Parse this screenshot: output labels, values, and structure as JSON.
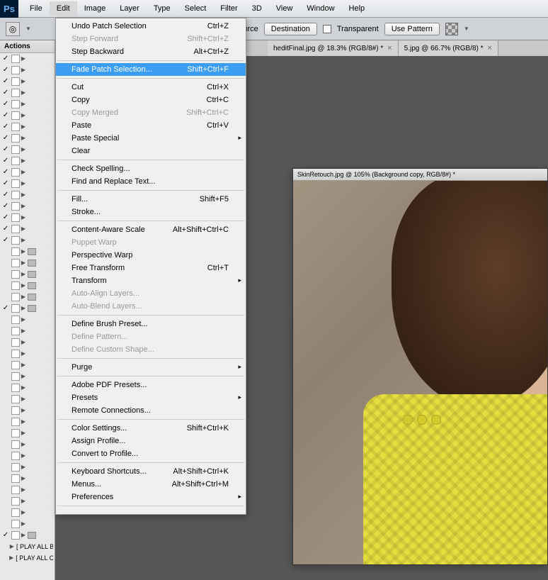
{
  "menubar": [
    "File",
    "Edit",
    "Image",
    "Layer",
    "Type",
    "Select",
    "Filter",
    "3D",
    "View",
    "Window",
    "Help"
  ],
  "active_menu": "Edit",
  "toolbar": {
    "source": "Source",
    "destination": "Destination",
    "transparent": "Transparent",
    "use_pattern": "Use Pattern"
  },
  "tabs": [
    {
      "label": "heditFinal.jpg @ 18.3% (RGB/8#) *"
    },
    {
      "label": "5.jpg @ 66.7% (RGB/8) *"
    }
  ],
  "doc_title": "SkinRetouch.jpg @ 105% (Background copy, RGB/8#) *",
  "actions_header": "Actions",
  "action_rows": [
    {
      "chk": true,
      "box": true,
      "arrow": true,
      "folder": false,
      "label": ""
    },
    {
      "chk": true,
      "box": true,
      "arrow": true,
      "folder": false,
      "label": ""
    },
    {
      "chk": true,
      "box": true,
      "arrow": true,
      "folder": false,
      "label": ""
    },
    {
      "chk": true,
      "box": true,
      "arrow": true,
      "folder": false,
      "label": ""
    },
    {
      "chk": true,
      "box": true,
      "arrow": true,
      "folder": false,
      "label": ""
    },
    {
      "chk": true,
      "box": true,
      "arrow": true,
      "folder": false,
      "label": ""
    },
    {
      "chk": true,
      "box": true,
      "arrow": true,
      "folder": false,
      "label": ""
    },
    {
      "chk": true,
      "box": true,
      "arrow": true,
      "folder": false,
      "label": ""
    },
    {
      "chk": true,
      "box": true,
      "arrow": true,
      "folder": false,
      "label": ""
    },
    {
      "chk": true,
      "box": true,
      "arrow": true,
      "folder": false,
      "label": ""
    },
    {
      "chk": true,
      "box": true,
      "arrow": true,
      "folder": false,
      "label": ""
    },
    {
      "chk": true,
      "box": true,
      "arrow": true,
      "folder": false,
      "label": ""
    },
    {
      "chk": true,
      "box": true,
      "arrow": true,
      "folder": false,
      "label": ""
    },
    {
      "chk": true,
      "box": true,
      "arrow": true,
      "folder": false,
      "label": ""
    },
    {
      "chk": true,
      "box": true,
      "arrow": true,
      "folder": false,
      "label": ""
    },
    {
      "chk": true,
      "box": true,
      "arrow": true,
      "folder": false,
      "label": ""
    },
    {
      "chk": true,
      "box": true,
      "arrow": true,
      "folder": false,
      "label": ""
    },
    {
      "chk": false,
      "box": true,
      "arrow": true,
      "folder": true,
      "label": ""
    },
    {
      "chk": false,
      "box": true,
      "arrow": true,
      "folder": true,
      "label": ""
    },
    {
      "chk": false,
      "box": true,
      "arrow": true,
      "folder": true,
      "label": ""
    },
    {
      "chk": false,
      "box": true,
      "arrow": true,
      "folder": true,
      "label": ""
    },
    {
      "chk": false,
      "box": true,
      "arrow": true,
      "folder": true,
      "label": ""
    },
    {
      "chk": true,
      "box": true,
      "arrow": true,
      "folder": true,
      "label": ""
    },
    {
      "chk": false,
      "box": true,
      "arrow": true,
      "folder": false,
      "label": ""
    },
    {
      "chk": false,
      "box": true,
      "arrow": true,
      "folder": false,
      "label": ""
    },
    {
      "chk": false,
      "box": true,
      "arrow": true,
      "folder": false,
      "label": ""
    },
    {
      "chk": false,
      "box": true,
      "arrow": true,
      "folder": false,
      "label": ""
    },
    {
      "chk": false,
      "box": true,
      "arrow": true,
      "folder": false,
      "label": ""
    },
    {
      "chk": false,
      "box": true,
      "arrow": true,
      "folder": false,
      "label": ""
    },
    {
      "chk": false,
      "box": true,
      "arrow": true,
      "folder": false,
      "label": ""
    },
    {
      "chk": false,
      "box": true,
      "arrow": true,
      "folder": false,
      "label": ""
    },
    {
      "chk": false,
      "box": true,
      "arrow": true,
      "folder": false,
      "label": ""
    },
    {
      "chk": false,
      "box": true,
      "arrow": true,
      "folder": false,
      "label": ""
    },
    {
      "chk": false,
      "box": true,
      "arrow": true,
      "folder": false,
      "label": ""
    },
    {
      "chk": false,
      "box": true,
      "arrow": true,
      "folder": false,
      "label": ""
    },
    {
      "chk": false,
      "box": true,
      "arrow": true,
      "folder": false,
      "label": ""
    },
    {
      "chk": false,
      "box": true,
      "arrow": true,
      "folder": false,
      "label": ""
    },
    {
      "chk": false,
      "box": true,
      "arrow": true,
      "folder": false,
      "label": ""
    },
    {
      "chk": false,
      "box": true,
      "arrow": true,
      "folder": false,
      "label": ""
    },
    {
      "chk": false,
      "box": true,
      "arrow": true,
      "folder": false,
      "label": ""
    },
    {
      "chk": false,
      "box": true,
      "arrow": true,
      "folder": false,
      "label": ""
    },
    {
      "chk": false,
      "box": true,
      "arrow": true,
      "folder": false,
      "label": ""
    },
    {
      "chk": true,
      "box": true,
      "arrow": true,
      "folder": true,
      "label": ""
    },
    {
      "chk": false,
      "box": false,
      "arrow": true,
      "folder": false,
      "label": "[ PLAY ALL B&W ACTIONS ]"
    },
    {
      "chk": false,
      "box": false,
      "arrow": true,
      "folder": false,
      "label": "[ PLAY ALL COLOR ACTION..."
    }
  ],
  "edit_menu": [
    {
      "label": "Undo Patch Selection",
      "sc": "Ctrl+Z",
      "enabled": true
    },
    {
      "label": "Step Forward",
      "sc": "Shift+Ctrl+Z",
      "enabled": false
    },
    {
      "label": "Step Backward",
      "sc": "Alt+Ctrl+Z",
      "enabled": true
    },
    {
      "sep": true
    },
    {
      "label": "Fade Patch Selection...",
      "sc": "Shift+Ctrl+F",
      "enabled": true,
      "selected": true
    },
    {
      "sep": true
    },
    {
      "label": "Cut",
      "sc": "Ctrl+X",
      "enabled": true
    },
    {
      "label": "Copy",
      "sc": "Ctrl+C",
      "enabled": true
    },
    {
      "label": "Copy Merged",
      "sc": "Shift+Ctrl+C",
      "enabled": false
    },
    {
      "label": "Paste",
      "sc": "Ctrl+V",
      "enabled": true
    },
    {
      "label": "Paste Special",
      "sc": "",
      "enabled": true,
      "submenu": true
    },
    {
      "label": "Clear",
      "sc": "",
      "enabled": true
    },
    {
      "sep": true
    },
    {
      "label": "Check Spelling...",
      "sc": "",
      "enabled": true
    },
    {
      "label": "Find and Replace Text...",
      "sc": "",
      "enabled": true
    },
    {
      "sep": true
    },
    {
      "label": "Fill...",
      "sc": "Shift+F5",
      "enabled": true
    },
    {
      "label": "Stroke...",
      "sc": "",
      "enabled": true
    },
    {
      "sep": true
    },
    {
      "label": "Content-Aware Scale",
      "sc": "Alt+Shift+Ctrl+C",
      "enabled": true
    },
    {
      "label": "Puppet Warp",
      "sc": "",
      "enabled": false
    },
    {
      "label": "Perspective Warp",
      "sc": "",
      "enabled": true
    },
    {
      "label": "Free Transform",
      "sc": "Ctrl+T",
      "enabled": true
    },
    {
      "label": "Transform",
      "sc": "",
      "enabled": true,
      "submenu": true
    },
    {
      "label": "Auto-Align Layers...",
      "sc": "",
      "enabled": false
    },
    {
      "label": "Auto-Blend Layers...",
      "sc": "",
      "enabled": false
    },
    {
      "sep": true
    },
    {
      "label": "Define Brush Preset...",
      "sc": "",
      "enabled": true
    },
    {
      "label": "Define Pattern...",
      "sc": "",
      "enabled": false
    },
    {
      "label": "Define Custom Shape...",
      "sc": "",
      "enabled": false
    },
    {
      "sep": true
    },
    {
      "label": "Purge",
      "sc": "",
      "enabled": true,
      "submenu": true
    },
    {
      "sep": true
    },
    {
      "label": "Adobe PDF Presets...",
      "sc": "",
      "enabled": true
    },
    {
      "label": "Presets",
      "sc": "",
      "enabled": true,
      "submenu": true
    },
    {
      "label": "Remote Connections...",
      "sc": "",
      "enabled": true
    },
    {
      "sep": true
    },
    {
      "label": "Color Settings...",
      "sc": "Shift+Ctrl+K",
      "enabled": true
    },
    {
      "label": "Assign Profile...",
      "sc": "",
      "enabled": true
    },
    {
      "label": "Convert to Profile...",
      "sc": "",
      "enabled": true
    },
    {
      "sep": true
    },
    {
      "label": "Keyboard Shortcuts...",
      "sc": "Alt+Shift+Ctrl+K",
      "enabled": true
    },
    {
      "label": "Menus...",
      "sc": "Alt+Shift+Ctrl+M",
      "enabled": true
    },
    {
      "label": "Preferences",
      "sc": "",
      "enabled": true,
      "submenu": true
    },
    {
      "sep": true
    },
    {
      "label": "",
      "sc": "",
      "enabled": false
    }
  ]
}
